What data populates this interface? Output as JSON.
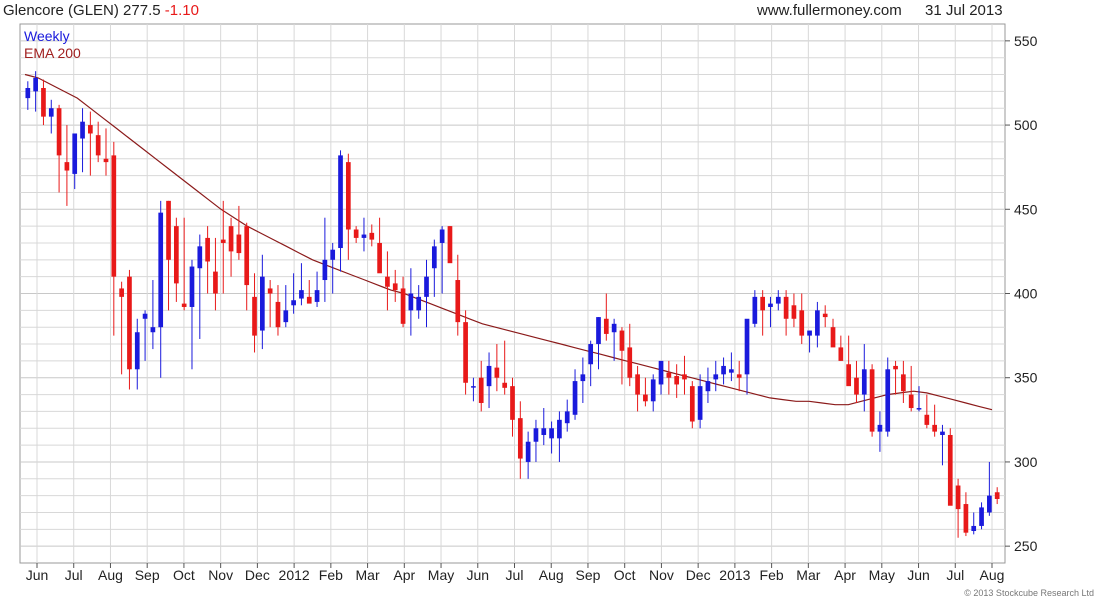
{
  "header": {
    "name": "Glencore (GLEN)",
    "price": "277.5",
    "change": "-1.10",
    "site": "www.fullermoney.com",
    "date": "31 Jul 2013"
  },
  "legend": {
    "period": "Weekly",
    "ema": "EMA 200"
  },
  "copyright": "© 2013 Stockcube Research Ltd",
  "colors": {
    "up": "#1a1adc",
    "down": "#e81919",
    "ema": "#8b1a1a",
    "grid": "#d8d8d8",
    "change": "#e81919",
    "legend_period": "#1a1adc",
    "legend_ema": "#a02020"
  },
  "chart_data": {
    "type": "candlestick",
    "ylim": [
      240,
      560
    ],
    "y_ticks": [
      250,
      300,
      350,
      400,
      450,
      500,
      550
    ],
    "x_labels": [
      "Jun",
      "Jul",
      "Aug",
      "Sep",
      "Oct",
      "Nov",
      "Dec",
      "2012",
      "Feb",
      "Mar",
      "Apr",
      "May",
      "Jun",
      "Jul",
      "Aug",
      "Sep",
      "Oct",
      "Nov",
      "Dec",
      "2013",
      "Feb",
      "Mar",
      "Apr",
      "May",
      "Jun",
      "Jul",
      "Aug"
    ],
    "candles": [
      [
        516,
        526,
        509,
        522
      ],
      [
        520,
        532,
        508,
        528
      ],
      [
        522,
        527,
        500,
        505
      ],
      [
        505,
        515,
        495,
        510
      ],
      [
        510,
        512,
        460,
        482
      ],
      [
        478,
        500,
        452,
        473
      ],
      [
        471,
        492,
        462,
        495
      ],
      [
        492,
        510,
        472,
        502
      ],
      [
        500,
        508,
        470,
        495
      ],
      [
        494,
        502,
        478,
        482
      ],
      [
        480,
        498,
        470,
        478
      ],
      [
        482,
        490,
        375,
        410
      ],
      [
        403,
        407,
        352,
        398
      ],
      [
        410,
        414,
        343,
        355
      ],
      [
        355,
        385,
        343,
        377
      ],
      [
        385,
        390,
        360,
        388
      ],
      [
        377,
        408,
        367,
        380
      ],
      [
        380,
        455,
        350,
        448
      ],
      [
        455,
        455,
        390,
        420
      ],
      [
        440,
        445,
        395,
        406
      ],
      [
        394,
        445,
        390,
        392
      ],
      [
        392,
        420,
        355,
        416
      ],
      [
        415,
        435,
        373,
        428
      ],
      [
        433,
        440,
        400,
        419
      ],
      [
        413,
        433,
        390,
        400
      ],
      [
        432,
        455,
        400,
        430
      ],
      [
        440,
        445,
        410,
        425
      ],
      [
        435,
        452,
        420,
        424
      ],
      [
        440,
        442,
        390,
        405
      ],
      [
        398,
        412,
        365,
        375
      ],
      [
        378,
        423,
        367,
        410
      ],
      [
        403,
        408,
        380,
        400
      ],
      [
        395,
        405,
        375,
        380
      ],
      [
        383,
        405,
        380,
        390
      ],
      [
        393,
        412,
        388,
        396
      ],
      [
        397,
        418,
        393,
        402
      ],
      [
        398,
        408,
        395,
        394
      ],
      [
        395,
        413,
        392,
        402
      ],
      [
        408,
        445,
        395,
        420
      ],
      [
        420,
        430,
        400,
        426
      ],
      [
        427,
        485,
        413,
        482
      ],
      [
        478,
        483,
        420,
        438
      ],
      [
        438,
        440,
        430,
        433
      ],
      [
        433,
        445,
        425,
        435
      ],
      [
        436,
        441,
        428,
        432
      ],
      [
        430,
        445,
        418,
        412
      ],
      [
        410,
        425,
        390,
        404
      ],
      [
        406,
        414,
        395,
        402
      ],
      [
        403,
        410,
        380,
        382
      ],
      [
        390,
        415,
        375,
        400
      ],
      [
        390,
        405,
        385,
        398
      ],
      [
        398,
        420,
        380,
        410
      ],
      [
        415,
        432,
        398,
        428
      ],
      [
        430,
        440,
        400,
        438
      ],
      [
        440,
        440,
        420,
        418
      ],
      [
        408,
        423,
        375,
        383
      ],
      [
        383,
        390,
        340,
        347
      ],
      [
        345,
        350,
        336,
        345
      ],
      [
        350,
        360,
        330,
        335
      ],
      [
        345,
        365,
        332,
        357
      ],
      [
        356,
        370,
        342,
        350
      ],
      [
        347,
        372,
        340,
        344
      ],
      [
        345,
        350,
        315,
        325
      ],
      [
        326,
        336,
        290,
        302
      ],
      [
        300,
        318,
        290,
        312
      ],
      [
        312,
        325,
        300,
        320
      ],
      [
        316,
        332,
        310,
        320
      ],
      [
        314,
        324,
        305,
        320
      ],
      [
        314,
        330,
        300,
        325
      ],
      [
        323,
        337,
        318,
        330
      ],
      [
        328,
        355,
        325,
        348
      ],
      [
        348,
        362,
        335,
        352
      ],
      [
        358,
        372,
        345,
        370
      ],
      [
        370,
        386,
        355,
        386
      ],
      [
        385,
        400,
        372,
        376
      ],
      [
        377,
        385,
        360,
        382
      ],
      [
        378,
        380,
        346,
        366
      ],
      [
        368,
        382,
        345,
        350
      ],
      [
        352,
        357,
        330,
        340
      ],
      [
        340,
        350,
        333,
        336
      ],
      [
        336,
        352,
        330,
        349
      ],
      [
        346,
        359,
        340,
        360
      ],
      [
        353,
        360,
        340,
        350
      ],
      [
        351,
        358,
        338,
        346
      ],
      [
        352,
        363,
        340,
        349
      ],
      [
        345,
        348,
        320,
        324
      ],
      [
        325,
        352,
        320,
        345
      ],
      [
        342,
        356,
        335,
        348
      ],
      [
        349,
        360,
        342,
        352
      ],
      [
        352,
        362,
        346,
        357
      ],
      [
        353,
        365,
        348,
        355
      ],
      [
        352,
        360,
        342,
        350
      ],
      [
        352,
        380,
        340,
        385
      ],
      [
        382,
        402,
        380,
        398
      ],
      [
        398,
        402,
        375,
        390
      ],
      [
        392,
        398,
        380,
        394
      ],
      [
        394,
        402,
        390,
        398
      ],
      [
        398,
        402,
        375,
        385
      ],
      [
        393,
        400,
        380,
        385
      ],
      [
        390,
        400,
        370,
        375
      ],
      [
        375,
        378,
        365,
        378
      ],
      [
        375,
        395,
        368,
        390
      ],
      [
        388,
        393,
        380,
        386
      ],
      [
        380,
        385,
        370,
        368
      ],
      [
        368,
        375,
        360,
        360
      ],
      [
        358,
        375,
        350,
        345
      ],
      [
        350,
        360,
        335,
        340
      ],
      [
        340,
        370,
        330,
        355
      ],
      [
        355,
        358,
        315,
        318
      ],
      [
        318,
        330,
        306,
        322
      ],
      [
        318,
        362,
        315,
        355
      ],
      [
        357,
        360,
        340,
        355
      ],
      [
        352,
        360,
        335,
        342
      ],
      [
        340,
        357,
        330,
        332
      ],
      [
        332,
        345,
        330,
        332
      ],
      [
        328,
        340,
        320,
        322
      ],
      [
        322,
        334,
        315,
        318
      ],
      [
        316,
        322,
        298,
        318
      ],
      [
        316,
        320,
        285,
        274
      ],
      [
        286,
        290,
        255,
        272
      ],
      [
        275,
        282,
        256,
        258
      ],
      [
        259,
        270,
        257,
        262
      ],
      [
        262,
        276,
        260,
        273
      ],
      [
        270,
        300,
        268,
        280
      ],
      [
        282,
        285,
        275,
        278
      ]
    ],
    "ema": [
      530,
      528,
      524,
      520,
      516,
      510,
      504,
      498,
      492,
      486,
      480,
      474,
      468,
      462,
      456,
      450,
      445,
      440,
      436,
      432,
      428,
      424,
      420,
      417,
      414,
      411,
      408,
      405,
      402,
      400,
      397,
      394,
      391,
      388,
      385,
      382,
      380,
      378,
      376,
      374,
      372,
      370,
      368,
      366,
      364,
      362,
      360,
      358,
      356,
      354,
      352,
      350,
      348,
      346,
      344,
      342,
      340,
      338,
      337,
      336,
      336,
      335,
      334,
      334,
      336,
      338,
      340,
      341,
      342,
      341,
      339,
      337,
      335,
      333,
      331
    ]
  }
}
